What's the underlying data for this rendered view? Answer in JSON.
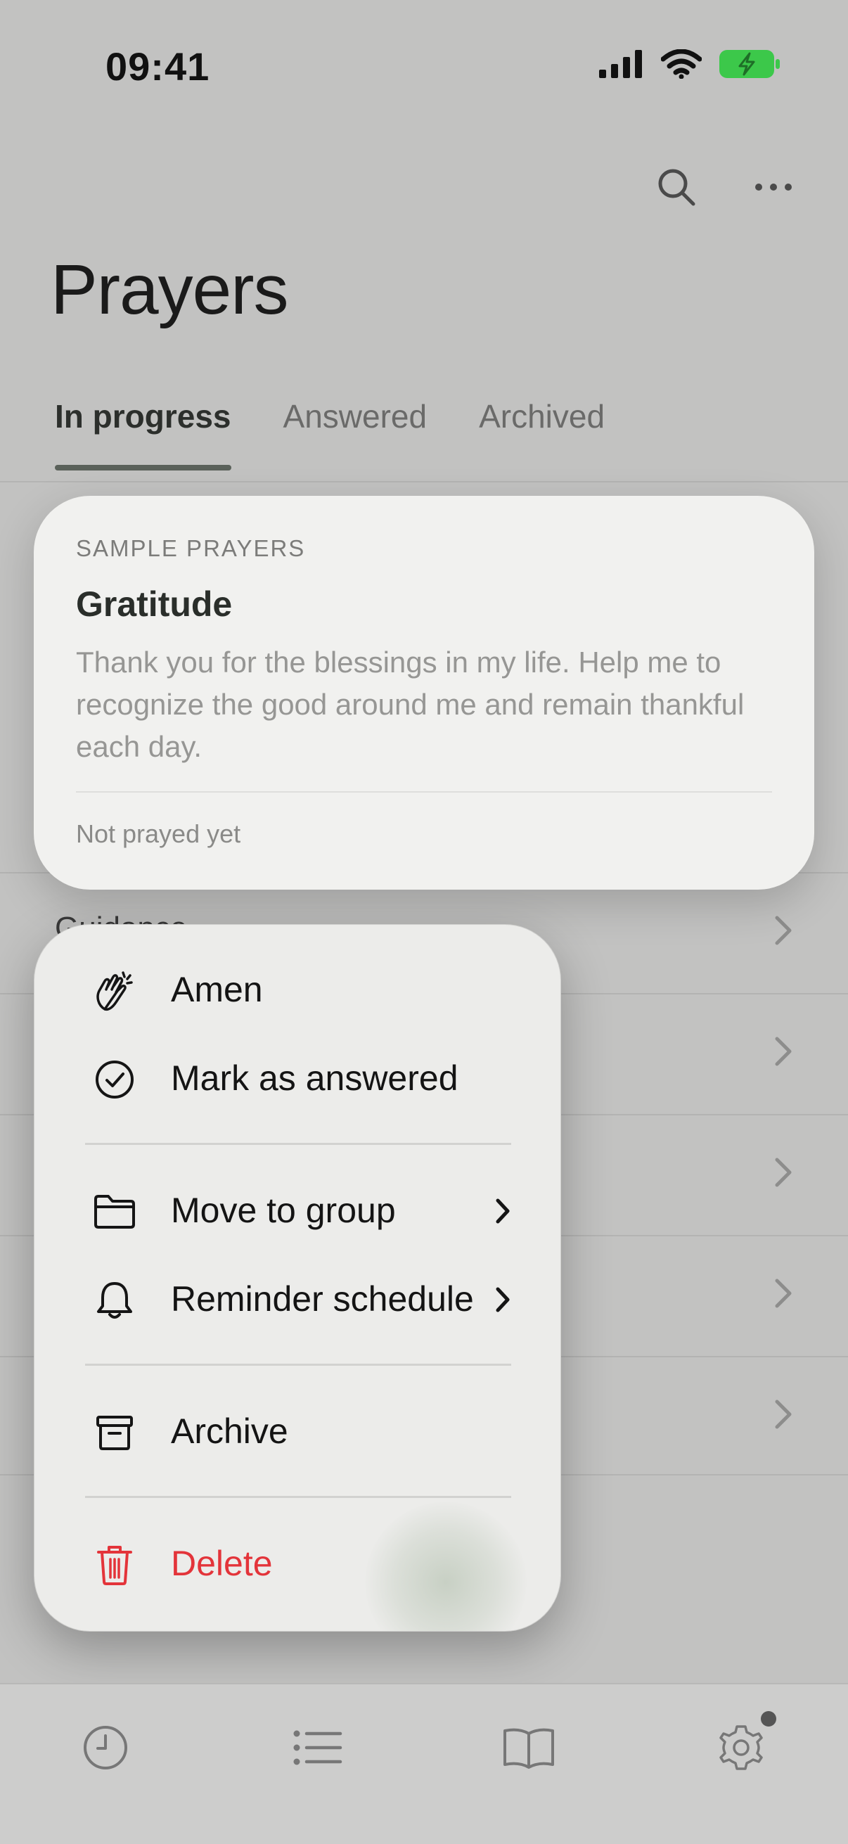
{
  "status_bar": {
    "time": "09:41",
    "icons": [
      "signal-icon",
      "wifi-icon",
      "battery-charging-icon"
    ],
    "battery_color": "#3cc84a"
  },
  "header": {
    "title": "Prayers",
    "actions": [
      "search-icon",
      "more-icon"
    ]
  },
  "tabs": [
    {
      "label": "In progress",
      "active": true
    },
    {
      "label": "Answered",
      "active": false
    },
    {
      "label": "Archived",
      "active": false
    }
  ],
  "preview_card": {
    "eyebrow": "SAMPLE PRAYERS",
    "title": "Gratitude",
    "body": "Thank you for the blessings in my life. Help me to recognize the good around me and remain thankful each day.",
    "status": "Not prayed yet"
  },
  "background_list": {
    "partial_label": "Guidance"
  },
  "context_menu": {
    "items": [
      {
        "label": "Amen",
        "icon": "clapping-hands-icon"
      },
      {
        "label": "Mark as answered",
        "icon": "check-circle-icon"
      },
      {
        "label": "Move to group",
        "icon": "folder-icon",
        "submenu": true
      },
      {
        "label": "Reminder schedule",
        "icon": "bell-icon",
        "submenu": true
      },
      {
        "label": "Archive",
        "icon": "archive-box-icon"
      },
      {
        "label": "Delete",
        "icon": "trash-icon",
        "destructive": true
      }
    ],
    "destructive_color": "#e3343a"
  },
  "tab_bar": {
    "items": [
      "clock-icon",
      "list-icon",
      "book-icon",
      "settings-gear-icon"
    ],
    "badge_on": "settings-gear-icon"
  }
}
